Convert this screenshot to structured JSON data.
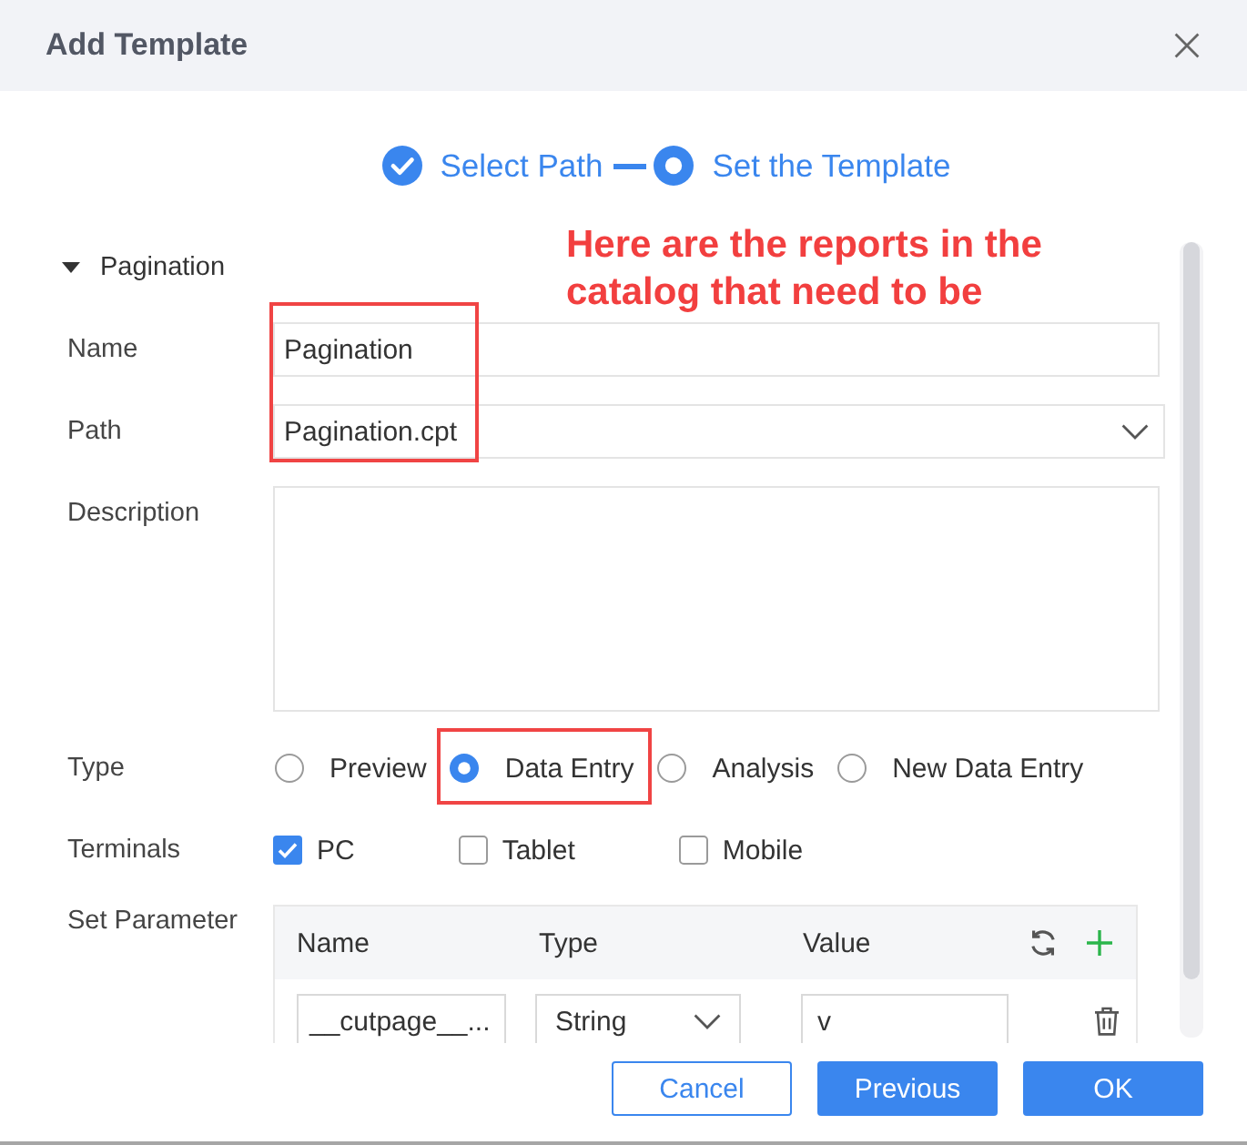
{
  "dialog": {
    "title": "Add Template"
  },
  "steps": [
    {
      "label": "Select Path",
      "completed": true
    },
    {
      "label": "Set the Template",
      "completed": false
    }
  ],
  "section": {
    "title": "Pagination",
    "expanded": true
  },
  "name_field": {
    "label": "Name",
    "value": "Pagination"
  },
  "path_field": {
    "label": "Path",
    "value": "Pagination.cpt"
  },
  "description_field": {
    "label": "Description"
  },
  "type": {
    "label": "Type",
    "options": [
      {
        "label": "Preview",
        "selected": false
      },
      {
        "label": "Data Entry",
        "selected": true
      },
      {
        "label": "Analysis",
        "selected": false
      },
      {
        "label": "New Data Entry",
        "selected": false
      }
    ]
  },
  "terminals": {
    "label": "Terminals",
    "options": [
      {
        "label": "PC",
        "checked": true
      },
      {
        "label": "Tablet",
        "checked": false
      },
      {
        "label": "Mobile",
        "checked": false
      }
    ]
  },
  "parameters": {
    "label": "Set Parameter",
    "columns": [
      "Name",
      "Type",
      "Value"
    ],
    "rows": [
      {
        "name": "__cutpage__...",
        "type": "String",
        "value": "v"
      }
    ]
  },
  "buttons": [
    {
      "label": "Cancel",
      "kind": "secondary"
    },
    {
      "label": "Previous",
      "kind": "primary"
    },
    {
      "label": "OK",
      "kind": "primary"
    }
  ],
  "annotation": {
    "text": "Here are the reports in the catalog that need to be"
  }
}
